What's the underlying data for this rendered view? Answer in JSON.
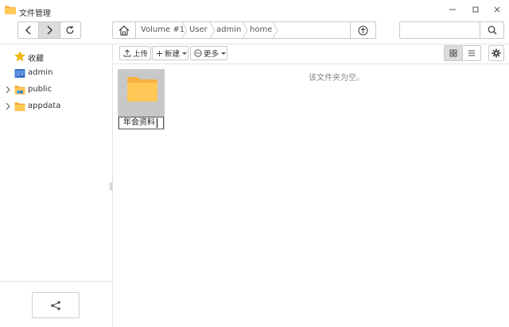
{
  "window": {
    "title": "文件管理",
    "minimize_label": "—",
    "maximize_label": "☐",
    "close_label": "✕"
  },
  "path": {
    "crumbs": [
      "Volume #1",
      "User",
      "admin",
      "home"
    ]
  },
  "search": {
    "value": "",
    "placeholder": ""
  },
  "sidebar": {
    "items": [
      {
        "label": "收藏",
        "icon": "star-icon",
        "expandable": false
      },
      {
        "label": "admin",
        "icon": "user-folder-icon",
        "expandable": false
      },
      {
        "label": "public",
        "icon": "shared-folder-icon",
        "expandable": true
      },
      {
        "label": "appdata",
        "icon": "folder-icon",
        "expandable": true
      }
    ]
  },
  "actions": {
    "upload_label": "上传",
    "new_label": "新建",
    "more_label": "更多"
  },
  "main": {
    "empty_message": "该文件夹为空。",
    "new_folder_name": "年会资料"
  },
  "colors": {
    "folder": "#FFC857",
    "folder_dark": "#F5B041",
    "selection_bg": "#C8C8C8",
    "active_button": "#DCDCDC"
  }
}
